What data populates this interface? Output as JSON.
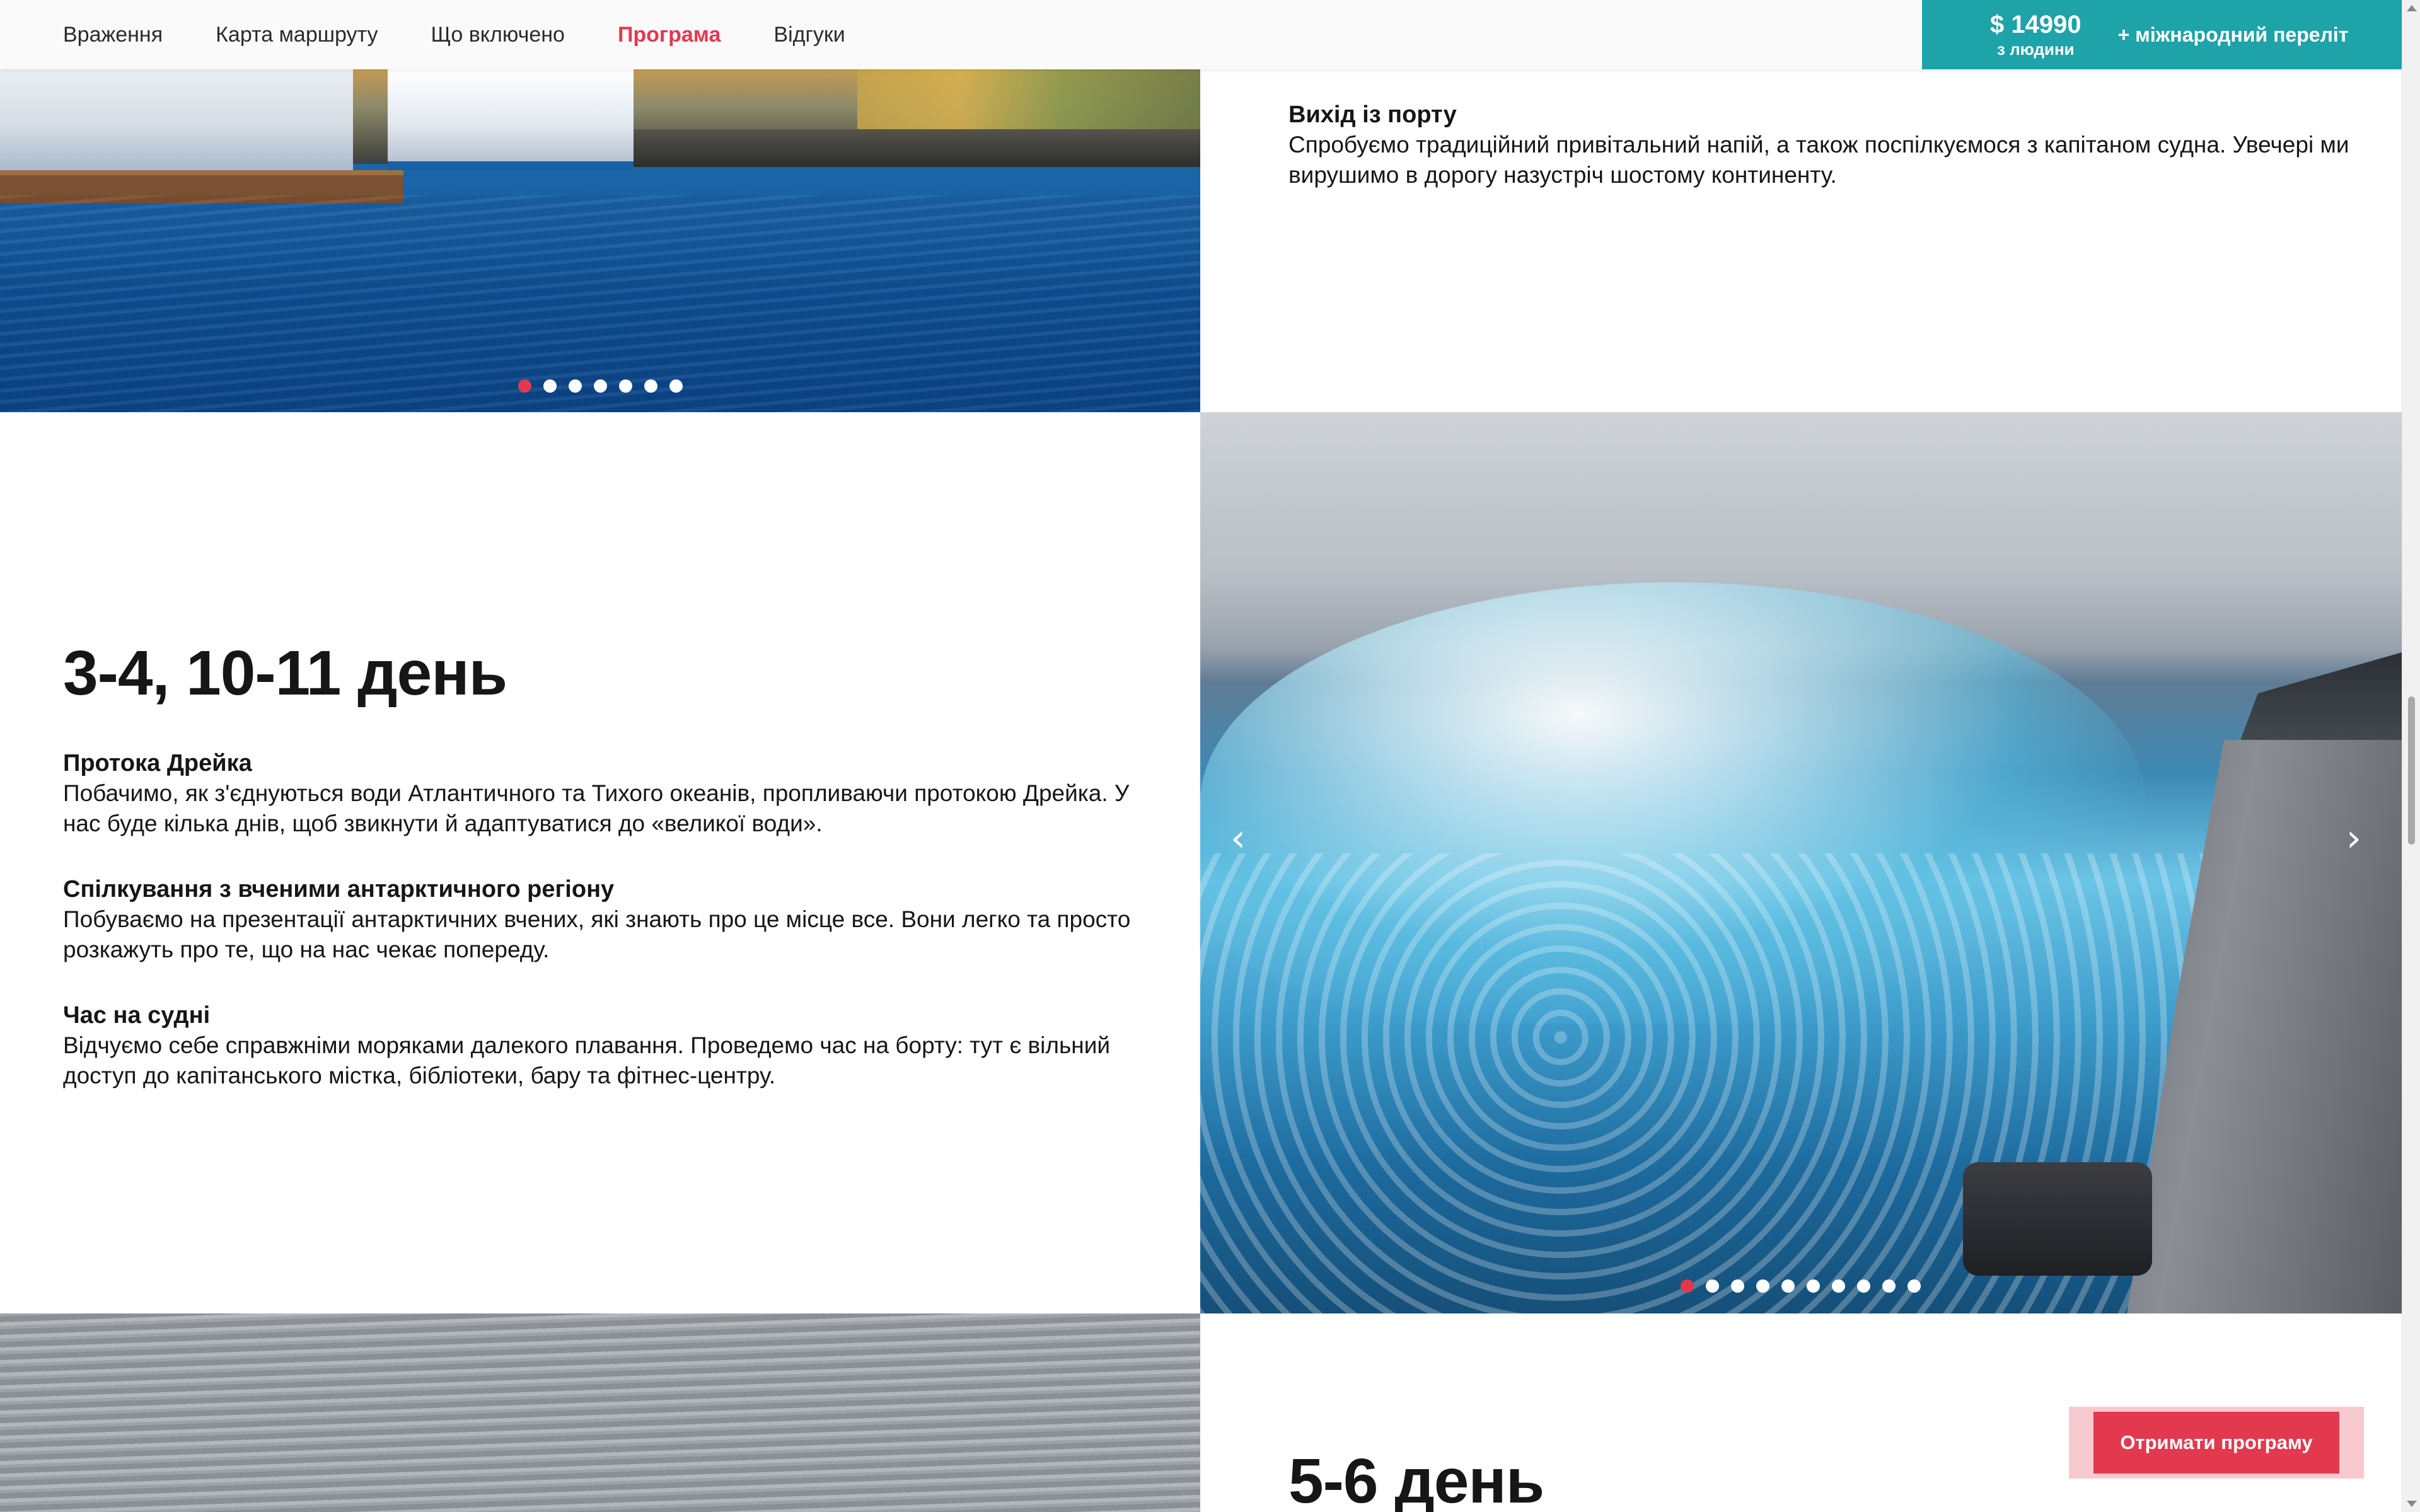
{
  "nav": {
    "items": [
      {
        "label": "Враження"
      },
      {
        "label": "Карта маршруту"
      },
      {
        "label": "Що включено"
      },
      {
        "label": "Програма"
      },
      {
        "label": "Відгуки"
      }
    ],
    "active": "Програма",
    "price": "$ 14990",
    "price_sub": "з людини",
    "price_extra": "+ міжнародний переліт"
  },
  "section1": {
    "items": [
      {
        "title": "Вихід із порту",
        "text": "Спробуємо традиційний привітальний напій, а також поспілкуємося з капітаном судна. Увечері ми вирушимо в дорогу назустріч шостому континенту."
      }
    ],
    "carousel": {
      "dots": 7,
      "active": 1
    }
  },
  "section2": {
    "heading": "3-4, 10-11 день",
    "items": [
      {
        "title": "Протока Дрейка",
        "text": "Побачимо, як з'єднуються води Атлантичного та Тихого океанів, пропливаючи протокою Дрейка. У нас буде кілька днів, щоб звикнути й адаптуватися до «великої води»."
      },
      {
        "title": "Спілкування з вченими антарктичного регіону",
        "text": "Побуваємо на презентації антарктичних вчених, які знають про це місце все. Вони легко та просто розкажуть про те, що на нас чекає попереду."
      },
      {
        "title": "Час на судні",
        "text": "Відчуємо себе справжніми моряками далекого плавання. Проведемо час на борту: тут є вільний доступ до капітанського містка, бібліотеки, бару та фітнес-центру."
      }
    ],
    "carousel": {
      "dots": 10,
      "active": 1,
      "prev_icon": "chevron-left-icon",
      "next_icon": "chevron-right-icon"
    }
  },
  "section3": {
    "heading": "5-6 день"
  },
  "cta": {
    "label": "Отримати програму"
  },
  "colors": {
    "accent": "#e2394f",
    "teal": "#1ea3a9"
  }
}
